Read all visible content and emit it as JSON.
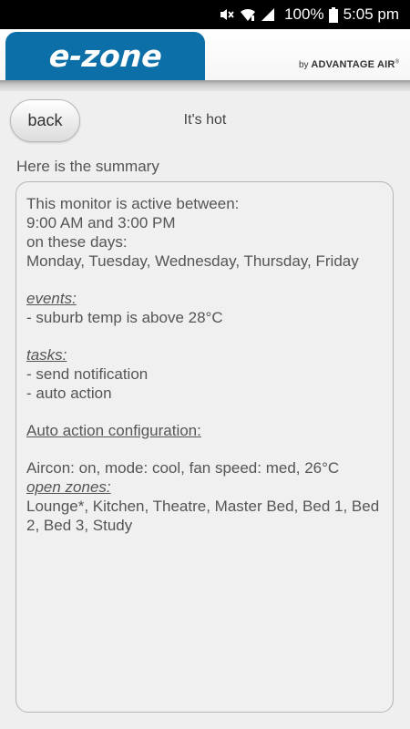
{
  "status_bar": {
    "battery": "100%",
    "time": "5:05 pm"
  },
  "header": {
    "logo": "e-zone",
    "brand_prefix": "by",
    "brand_name": "ADVANTAGE AIR",
    "brand_mark": "®"
  },
  "nav": {
    "back_label": "back",
    "title": "It's hot"
  },
  "intro": "Here is the summary",
  "summary": {
    "active_heading": "This monitor is active between:",
    "time_range": "9:00 AM and 3:00 PM",
    "days_heading": "on these days:",
    "days": "Monday, Tuesday, Wednesday, Thursday, Friday",
    "events_heading": "events:",
    "events": [
      "- suburb temp is above 28°C"
    ],
    "tasks_heading": "tasks:",
    "tasks": [
      "- send notification",
      "- auto action"
    ],
    "auto_heading": "Auto action configuration:",
    "aircon": "Aircon: on, mode: cool, fan speed: med, 26°C",
    "zones_heading": "open zones:",
    "zones": "Lounge*, Kitchen, Theatre, Master Bed, Bed 1, Bed 2, Bed 3, Study"
  }
}
